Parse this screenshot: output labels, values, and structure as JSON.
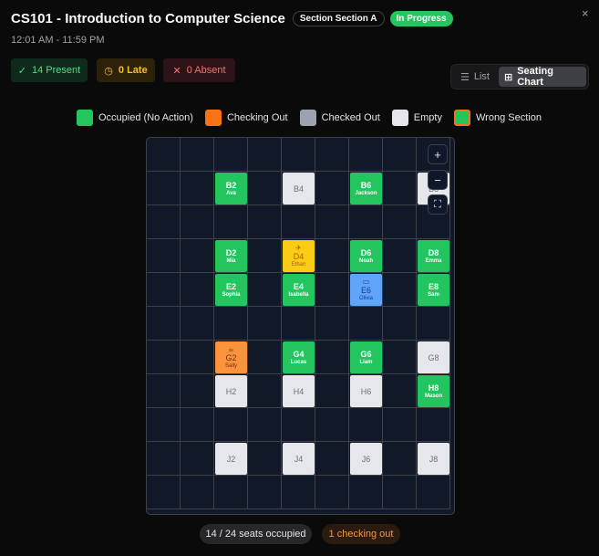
{
  "header": {
    "title": "CS101 - Introduction to Computer Science",
    "section_badge": "Section Section A",
    "status_badge": "In Progress",
    "time": "12:01 AM - 11:59 PM",
    "close": "×"
  },
  "stats": {
    "present": "14 Present",
    "late": "0 Late",
    "absent": "0 Absent"
  },
  "view_toggle": {
    "list": "List",
    "seating_chart": "Seating Chart",
    "selected": "Seating Chart"
  },
  "legend": [
    {
      "label": "Occupied (No Action)",
      "color": "#22c55e"
    },
    {
      "label": "Checking Out",
      "color": "#f97316"
    },
    {
      "label": "Checked Out",
      "color": "#9ca3af"
    },
    {
      "label": "Empty",
      "color": "#e5e7eb"
    },
    {
      "label": "Wrong Section",
      "color": "#22c55e",
      "border": "#f97316"
    }
  ],
  "seats": [
    {
      "code": "B2",
      "name": "Ava",
      "status": "occupied"
    },
    {
      "code": "B4",
      "name": "",
      "status": "empty"
    },
    {
      "code": "B6",
      "name": "Jackson",
      "status": "occupied"
    },
    {
      "code": "B8",
      "name": "",
      "status": "empty"
    },
    {
      "code": "D2",
      "name": "Mia",
      "status": "occupied"
    },
    {
      "code": "D4",
      "name": "Ethan",
      "status": "late",
      "icon": "hall-pass-icon"
    },
    {
      "code": "D6",
      "name": "Noah",
      "status": "occupied"
    },
    {
      "code": "D8",
      "name": "Emma",
      "status": "occupied"
    },
    {
      "code": "E2",
      "name": "Sophia",
      "status": "occupied"
    },
    {
      "code": "E4",
      "name": "Isabella",
      "status": "occupied"
    },
    {
      "code": "E6",
      "name": "Olivia",
      "status": "blue",
      "icon": "monitor-icon"
    },
    {
      "code": "E8",
      "name": "Sam",
      "status": "occupied"
    },
    {
      "code": "G2",
      "name": "Sally",
      "status": "orange",
      "icon": "coffee-icon"
    },
    {
      "code": "G4",
      "name": "Lucas",
      "status": "occupied"
    },
    {
      "code": "G6",
      "name": "Liam",
      "status": "occupied"
    },
    {
      "code": "G8",
      "name": "",
      "status": "empty"
    },
    {
      "code": "H2",
      "name": "",
      "status": "empty"
    },
    {
      "code": "H4",
      "name": "",
      "status": "empty"
    },
    {
      "code": "H6",
      "name": "",
      "status": "empty"
    },
    {
      "code": "H8",
      "name": "Mason",
      "status": "occupied"
    },
    {
      "code": "J2",
      "name": "",
      "status": "empty"
    },
    {
      "code": "J4",
      "name": "",
      "status": "empty"
    },
    {
      "code": "J6",
      "name": "",
      "status": "empty"
    },
    {
      "code": "J8",
      "name": "",
      "status": "empty"
    }
  ],
  "zoom": {
    "in": "+",
    "out": "−",
    "fit": "⛶"
  },
  "footer": {
    "occupied": "14 / 24 seats occupied",
    "checking_out": "1 checking out"
  }
}
